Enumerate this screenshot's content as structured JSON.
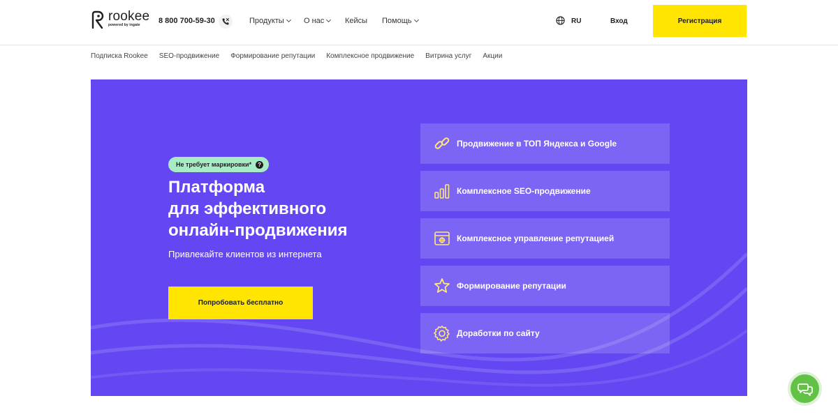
{
  "header": {
    "logo": {
      "word": "rookee",
      "sub": "powered by ingate"
    },
    "phone": "8 800 700-59-30",
    "nav": [
      {
        "label": "Продукты",
        "has_dropdown": true
      },
      {
        "label": "О нас",
        "has_dropdown": true
      },
      {
        "label": "Кейсы",
        "has_dropdown": false
      },
      {
        "label": "Помощь",
        "has_dropdown": true
      }
    ],
    "lang": "RU",
    "login_label": "Вход",
    "register_label": "Регистрация"
  },
  "subnav": [
    "Подписка Rookee",
    "SEO-продвижение",
    "Формирование репутации",
    "Комплексное продвижение",
    "Витрина услуг",
    "Акции"
  ],
  "hero": {
    "badge": "Не требует маркировки*",
    "badge_help": "?",
    "title_lines": [
      "Платформа",
      "для эффективного",
      "онлайн-продвижения"
    ],
    "subtitle": "Привлекайте клиентов из интернета",
    "cta_label": "Попробовать бесплатно",
    "services": [
      {
        "label": "Продвижение в ТОП Яндекса и Google",
        "icon": "link-icon"
      },
      {
        "label": "Комплексное SEO-продвижение",
        "icon": "bar-chart-icon"
      },
      {
        "label": "Комплексное управление репутацией",
        "icon": "browser-window-icon"
      },
      {
        "label": "Формирование репутации",
        "icon": "star-icon"
      },
      {
        "label": "Доработки по сайту",
        "icon": "gear-icon"
      }
    ]
  },
  "colors": {
    "brand_purple": "#6447f3",
    "accent_yellow": "#ffe500",
    "badge_green": "#a8ecc6",
    "chat_green": "#62c246",
    "icon_yellow": "#ffe87a"
  }
}
